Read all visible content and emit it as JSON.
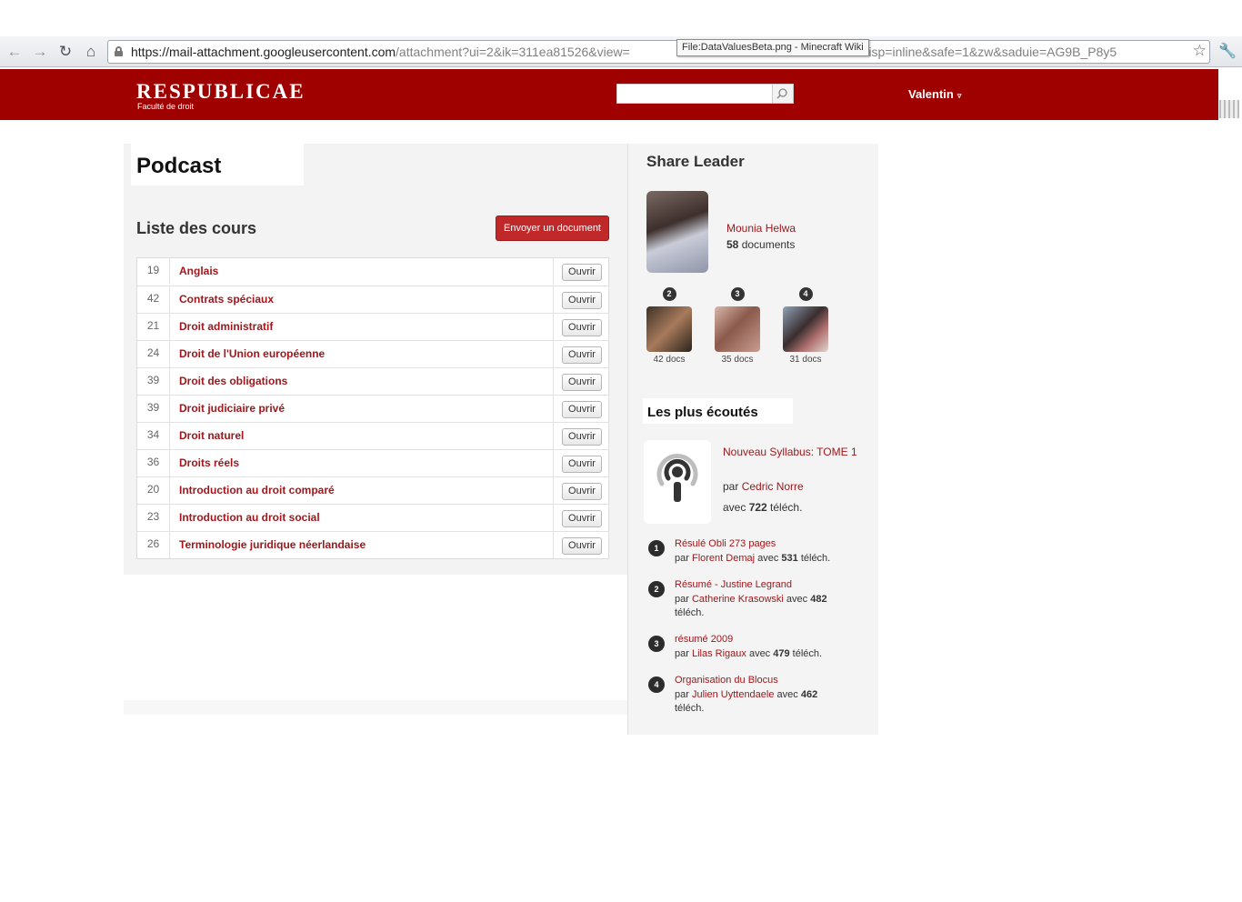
{
  "browser": {
    "url_host": "https://mail-attachment.googleusercontent.com",
    "url_path": "/attachment?ui=2&ik=311ea81526&view=",
    "url_tail": "0.1&disp=inline&safe=1&zw&saduie=AG9B_P8y5",
    "tooltip": "File:DataValuesBeta.png - Minecraft Wiki",
    "icons": [
      "back-icon",
      "forward-icon",
      "reload-icon",
      "home-icon",
      "lock-icon",
      "star-icon",
      "wrench-icon"
    ]
  },
  "header": {
    "logo": "RESPUBLICAE",
    "logo_sub": "Faculté de droit",
    "search_placeholder": "",
    "user": "Valentin",
    "user_arrow": "▿",
    "brand_color": "#9f0000"
  },
  "main": {
    "title": "Podcast",
    "section_title": "Liste des cours",
    "send_button": "Envoyer un document",
    "open_label": "Ouvrir",
    "courses": [
      {
        "count": "19",
        "name": "Anglais"
      },
      {
        "count": "42",
        "name": "Contrats spéciaux"
      },
      {
        "count": "21",
        "name": "Droit administratif"
      },
      {
        "count": "24",
        "name": "Droit de l'Union européenne"
      },
      {
        "count": "39",
        "name": "Droit des obligations"
      },
      {
        "count": "39",
        "name": "Droit judiciaire privé"
      },
      {
        "count": "34",
        "name": "Droit naturel"
      },
      {
        "count": "36",
        "name": "Droits réels"
      },
      {
        "count": "20",
        "name": "Introduction au droit comparé"
      },
      {
        "count": "23",
        "name": "Introduction au droit social"
      },
      {
        "count": "26",
        "name": "Terminologie juridique néerlandaise"
      }
    ]
  },
  "sidebar": {
    "share_title": "Share Leader",
    "leader": {
      "name": "Mounia Helwa",
      "docs_count": "58",
      "docs_label": " documents"
    },
    "ranks": [
      {
        "rank": "2",
        "docs": "42 docs"
      },
      {
        "rank": "3",
        "docs": "35 docs"
      },
      {
        "rank": "4",
        "docs": "31 docs"
      }
    ],
    "listened_title": "Les plus écoutés",
    "featured": {
      "title": "Nouveau Syllabus: TOME 1",
      "by": "par ",
      "author": "Cedric Norre",
      "count_prefix": "avec ",
      "count": "722",
      "count_suffix": " téléch."
    },
    "top": [
      {
        "num": "1",
        "title": "Résulé Obli 273 pages",
        "by": "par ",
        "author": "Florent Demaj",
        "with": " avec ",
        "count": "531",
        "suffix": " téléch."
      },
      {
        "num": "2",
        "title": "Résumé - Justine Legrand",
        "by": "par ",
        "author": "Catherine Krasowski",
        "with": " avec ",
        "count": "482",
        "suffix": " téléch."
      },
      {
        "num": "3",
        "title": "résumé 2009",
        "by": "par ",
        "author": "Lilas Rigaux",
        "with": " avec ",
        "count": "479",
        "suffix": " téléch."
      },
      {
        "num": "4",
        "title": "Organisation du Blocus",
        "by": "par ",
        "author": "Julien Uyttendaele",
        "with": " avec ",
        "count": "462",
        "suffix": " téléch."
      }
    ]
  }
}
